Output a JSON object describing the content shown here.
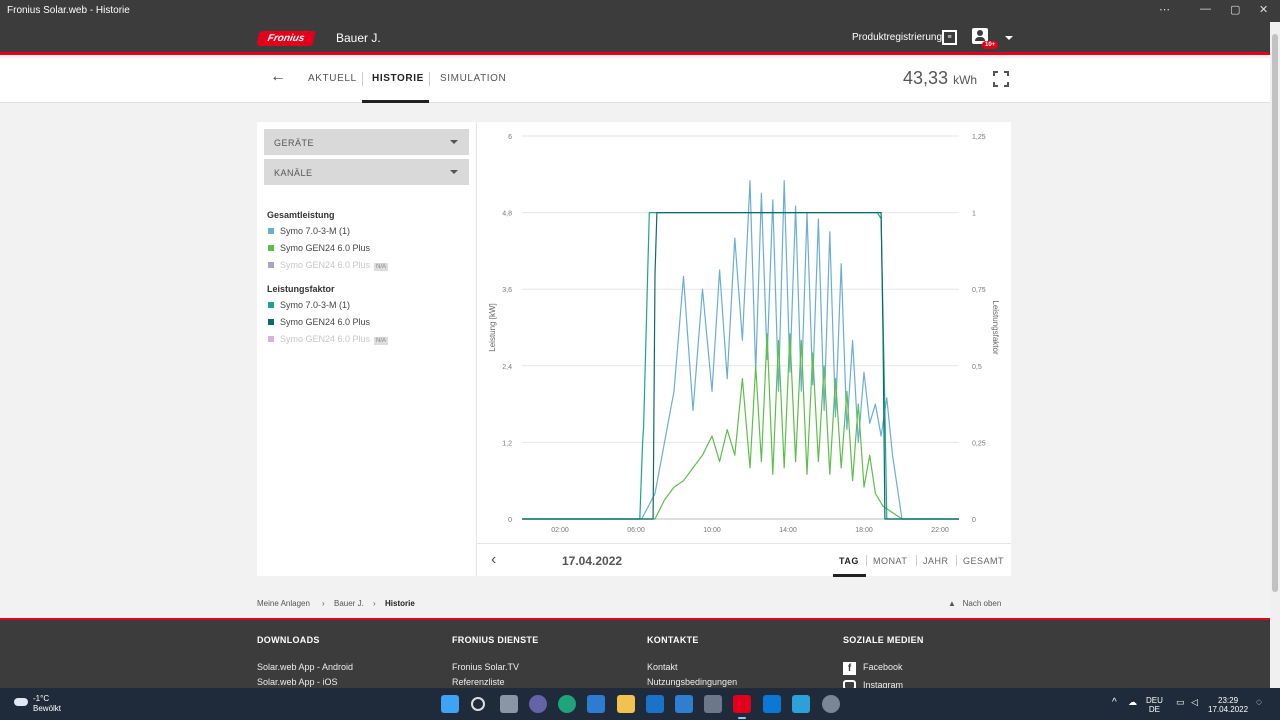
{
  "window": {
    "title": "Fronius Solar.web - Historie"
  },
  "header": {
    "logo_text": "Fronius",
    "plant_name": "Bauer J.",
    "product_registration": "Produktregistrierung",
    "notification_badge": "10+"
  },
  "nav": {
    "tabs": [
      "AKTUELL",
      "HISTORIE",
      "SIMULATION"
    ],
    "active_tab": "HISTORIE",
    "energy_value": "43,33",
    "energy_unit": "kWh"
  },
  "filters": {
    "devices_label": "GERÄTE",
    "channels_label": "KANÄLE"
  },
  "legend": {
    "groups": [
      {
        "title": "Gesamtleistung",
        "items": [
          {
            "label": "Symo 7.0-3-M (1)",
            "color": "#6aaed6",
            "na": ""
          },
          {
            "label": "Symo GEN24 6.0 Plus",
            "color": "#5cbf4a",
            "na": ""
          },
          {
            "label": "Symo GEN24 6.0 Plus",
            "color": "#a6a4c9",
            "na": "N/A"
          }
        ]
      },
      {
        "title": "Leistungsfaktor",
        "items": [
          {
            "label": "Symo 7.0-3-M (1)",
            "color": "#1aa58f",
            "na": ""
          },
          {
            "label": "Symo GEN24 6.0 Plus",
            "color": "#0e6b6b",
            "na": ""
          },
          {
            "label": "Symo GEN24 6.0 Plus",
            "color": "#dcb0dc",
            "na": "N/A"
          }
        ]
      }
    ]
  },
  "chart_data": {
    "type": "line",
    "xlabel": "",
    "ylabel": "Leistung [kW]",
    "y2label": "Leistungsfaktor",
    "ylim": [
      0,
      6
    ],
    "y2lim": [
      0,
      1.25
    ],
    "xlim": [
      0,
      23
    ],
    "x_ticks": [
      "02:00",
      "06:00",
      "10:00",
      "14:00",
      "18:00",
      "22:00"
    ],
    "x_tick_values": [
      2,
      6,
      10,
      14,
      18,
      22
    ],
    "y_ticks": [
      "0",
      "1,2",
      "2,4",
      "3,6",
      "4,8",
      "6"
    ],
    "y_tick_values": [
      0,
      1.2,
      2.4,
      3.6,
      4.8,
      6
    ],
    "y2_ticks": [
      "0",
      "0,25",
      "0,5",
      "0,75",
      "1",
      "1,25"
    ],
    "y2_tick_values": [
      0,
      0.25,
      0.5,
      0.75,
      1,
      1.25
    ],
    "grid": true,
    "series": [
      {
        "name": "Symo 7.0-3-M (1)",
        "axis": "left",
        "color": "#6aaed6",
        "x": [
          0,
          6.3,
          7.0,
          7.5,
          8.0,
          8.5,
          9.0,
          9.5,
          10.0,
          10.4,
          10.8,
          11.2,
          11.6,
          12.0,
          12.3,
          12.6,
          12.9,
          13.2,
          13.5,
          13.8,
          14.1,
          14.4,
          14.7,
          15.0,
          15.3,
          15.6,
          15.9,
          16.2,
          16.5,
          16.8,
          17.1,
          17.4,
          17.7,
          18.0,
          18.3,
          18.6,
          18.9,
          19.2,
          19.5,
          20.0,
          23.0
        ],
        "y": [
          0,
          0,
          0.4,
          1.2,
          2.0,
          3.8,
          1.7,
          3.6,
          2.0,
          3.9,
          2.2,
          4.4,
          2.8,
          5.3,
          2.3,
          5.1,
          2.5,
          5.0,
          2.0,
          5.3,
          2.3,
          4.9,
          2.0,
          4.8,
          2.1,
          4.7,
          1.7,
          4.5,
          1.6,
          4.0,
          1.4,
          2.8,
          1.2,
          2.3,
          1.5,
          1.8,
          1.3,
          1.9,
          1.0,
          0,
          0
        ]
      },
      {
        "name": "Symo GEN24 6.0 Plus",
        "axis": "left",
        "color": "#5cbf4a",
        "x": [
          0,
          7.0,
          7.5,
          8.0,
          8.5,
          9.0,
          9.5,
          10.0,
          10.4,
          10.8,
          11.2,
          11.6,
          12.0,
          12.3,
          12.6,
          12.9,
          13.2,
          13.5,
          13.8,
          14.1,
          14.4,
          14.7,
          15.0,
          15.3,
          15.6,
          15.9,
          16.2,
          16.5,
          16.8,
          17.1,
          17.4,
          17.7,
          18.0,
          18.3,
          18.6,
          19.0,
          19.5,
          20.0,
          23.0
        ],
        "y": [
          0,
          0,
          0.3,
          0.5,
          0.6,
          0.8,
          1.0,
          1.3,
          0.9,
          1.4,
          1.0,
          2.2,
          0.8,
          2.4,
          0.9,
          2.9,
          0.7,
          2.8,
          0.8,
          2.9,
          0.9,
          2.8,
          0.7,
          2.6,
          0.9,
          2.4,
          0.7,
          2.2,
          0.8,
          2.0,
          0.6,
          1.8,
          0.5,
          1.0,
          0.4,
          0.2,
          0.1,
          0,
          0
        ]
      },
      {
        "name": "Symo 7.0-3-M (1)",
        "axis": "right",
        "color": "#1aa58f",
        "x": [
          0,
          6.2,
          6.35,
          6.4,
          6.7,
          12.0,
          18.7,
          18.9,
          19.1,
          19.2,
          23.0
        ],
        "y": [
          0,
          0,
          0.25,
          0.3,
          1.0,
          1.0,
          1.0,
          0.98,
          0.35,
          0,
          0
        ]
      },
      {
        "name": "Symo GEN24 6.0 Plus",
        "axis": "right",
        "color": "#0e6b6b",
        "x": [
          0,
          6.9,
          7.0,
          7.1,
          12.0,
          18.9,
          19.0,
          19.1,
          23.0
        ],
        "y": [
          0,
          0,
          0.8,
          1.0,
          1.0,
          1.0,
          0.6,
          0,
          0
        ]
      }
    ]
  },
  "chart_footer": {
    "date": "17.04.2022",
    "periods": [
      "TAG",
      "MONAT",
      "JAHR",
      "GESAMT"
    ],
    "active_period": "TAG"
  },
  "breadcrumb": [
    "Meine Anlagen",
    "Bauer J.",
    "Historie"
  ],
  "back_to_top": "Nach oben",
  "footer": {
    "columns": [
      {
        "title": "DOWNLOADS",
        "links": [
          "Solar.web App - Android",
          "Solar.web App - iOS"
        ]
      },
      {
        "title": "FRONIUS DIENSTE",
        "links": [
          "Fronius Solar.TV",
          "Referenzliste"
        ]
      },
      {
        "title": "KONTAKTE",
        "links": [
          "Kontakt",
          "Nutzungsbedingungen"
        ]
      },
      {
        "title": "SOZIALE MEDIEN",
        "links": [
          "Facebook",
          "Instagram"
        ]
      }
    ]
  },
  "taskbar": {
    "temp": "-1°C",
    "weather": "Bewölkt",
    "lang1": "DEU",
    "lang2": "DE",
    "time": "23:29",
    "date": "17.04.2022"
  }
}
